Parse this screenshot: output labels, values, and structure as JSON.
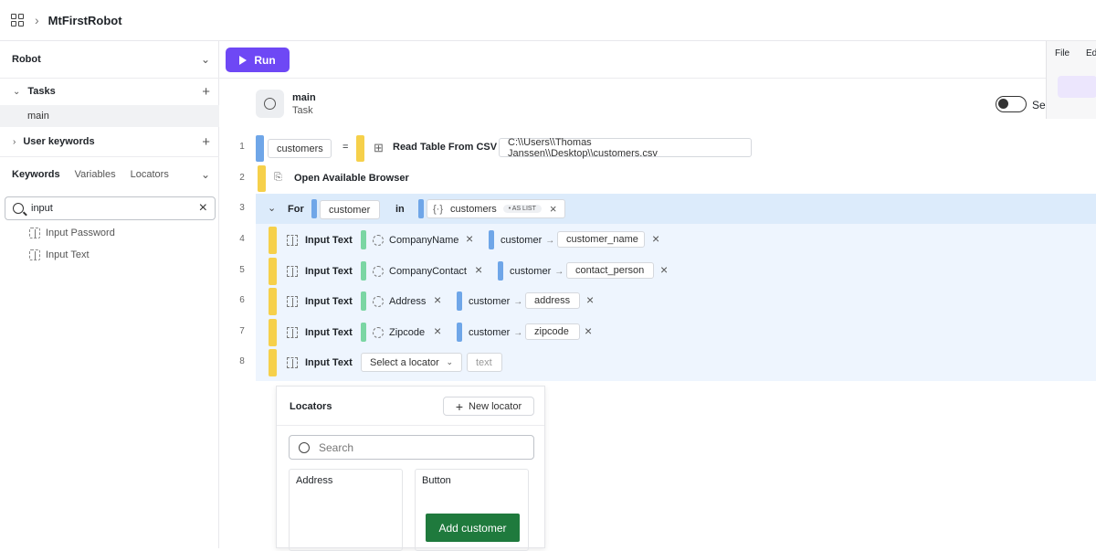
{
  "app": {
    "title": "MtFirstRobot"
  },
  "sidebar": {
    "robot_label": "Robot",
    "tasks_label": "Tasks",
    "task_items": [
      "main"
    ],
    "user_keywords_label": "User keywords",
    "tabs": [
      "Keywords",
      "Variables",
      "Locators"
    ],
    "search_value": "input",
    "keyword_results": [
      "Input Password",
      "Input Text"
    ]
  },
  "toolbar": {
    "run_label": "Run"
  },
  "right_menu": {
    "file": "File",
    "edit": "Ed"
  },
  "task": {
    "name": "main",
    "type": "Task",
    "toggle_label": "Se"
  },
  "rows": {
    "r1": {
      "num": "1",
      "var": "customers",
      "eq": "=",
      "keyword": "Read Table From CSV",
      "arg": "C:\\\\Users\\\\Thomas Janssen\\\\Desktop\\\\customers.csv"
    },
    "r2": {
      "num": "2",
      "keyword": "Open Available Browser"
    },
    "r3": {
      "num": "3",
      "keyword": "For",
      "var": "customer",
      "in": "in",
      "iter": "customers",
      "badge": "• AS LIST"
    },
    "r4": {
      "num": "4",
      "keyword": "Input Text",
      "locator": "CompanyName",
      "src": "customer",
      "field": "customer_name"
    },
    "r5": {
      "num": "5",
      "keyword": "Input Text",
      "locator": "CompanyContact",
      "src": "customer",
      "field": "contact_person"
    },
    "r6": {
      "num": "6",
      "keyword": "Input Text",
      "locator": "Address",
      "src": "customer",
      "field": "address"
    },
    "r7": {
      "num": "7",
      "keyword": "Input Text",
      "locator": "Zipcode",
      "src": "customer",
      "field": "zipcode"
    },
    "r8": {
      "num": "8",
      "keyword": "Input Text",
      "locator_placeholder": "Select a locator",
      "text_placeholder": "text"
    }
  },
  "locators_panel": {
    "title": "Locators",
    "new_locator": "New locator",
    "search_placeholder": "Search",
    "cards": [
      {
        "title": "Address"
      },
      {
        "title": "Button",
        "preview_button": "Add customer"
      }
    ]
  },
  "colors": {
    "run": "#6e48f5",
    "preview_button": "#1f7a3d"
  }
}
